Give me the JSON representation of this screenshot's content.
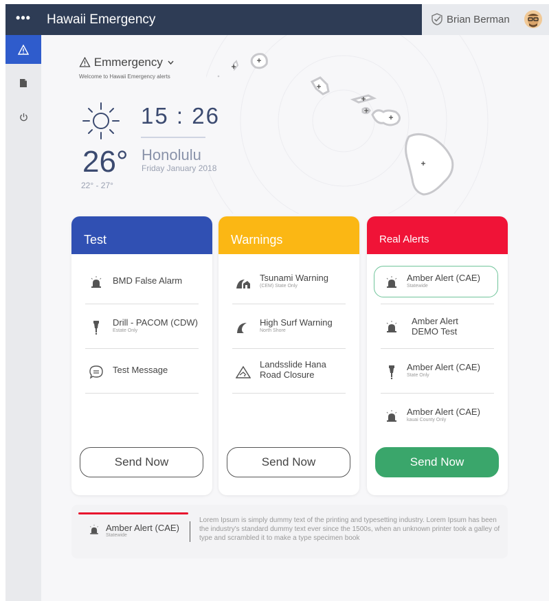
{
  "topbar": {
    "menu_glyph": "•••",
    "title": "Hawaii Emergency",
    "user_name": "Brian Berman"
  },
  "sidebar": {
    "items": [
      {
        "icon": "warning-icon",
        "glyph": "⚠",
        "active": true
      },
      {
        "icon": "document-icon",
        "glyph": "▮",
        "active": false
      },
      {
        "icon": "power-icon",
        "glyph": "⏻",
        "active": false
      }
    ]
  },
  "header": {
    "section_title": "Emmergency",
    "subtitle": "Welcome to Hawaii Emergency alerts",
    "time": "15 : 26",
    "temperature": "26°",
    "city": "Honolulu",
    "date": "Friday  January  2018",
    "temp_range": "22° - 27°"
  },
  "cards": [
    {
      "title": "Test",
      "color": "#3050b3",
      "items": [
        {
          "icon": "siren-icon",
          "label": "BMD False Alarm",
          "sub": ""
        },
        {
          "icon": "sprinkler-icon",
          "label": "Drill - PACOM (CDW)",
          "sub": "Estate Only"
        },
        {
          "icon": "chat-bubble-icon",
          "label": "Test Message",
          "sub": ""
        }
      ],
      "button": "Send Now"
    },
    {
      "title": "Warnings",
      "color": "#fbb714",
      "items": [
        {
          "icon": "tsunami-icon",
          "label": "Tsunami Warning",
          "sub": "(CEM) State Only"
        },
        {
          "icon": "wave-icon",
          "label": "High Surf Warning",
          "sub": "North Shore"
        },
        {
          "icon": "landslide-icon",
          "label": "Landsslide Hana Road Closure",
          "sub": ""
        }
      ],
      "button": "Send Now"
    },
    {
      "title": "Real Alerts",
      "color": "#f01337",
      "items": [
        {
          "icon": "siren-icon",
          "label": "Amber Alert (CAE)",
          "sub": "Statewide"
        },
        {
          "icon": "siren-icon",
          "label": "Amber Alert DEMO Test",
          "sub": ""
        },
        {
          "icon": "sprinkler-icon",
          "label": "Amber Alert (CAE)",
          "sub": "State Only"
        },
        {
          "icon": "siren-icon",
          "label": "Amber Alert (CAE)",
          "sub": "kauai County Only"
        }
      ],
      "button": "Send Now"
    }
  ],
  "info": {
    "name": "Amber Alert (CAE)",
    "sub": "Statewide",
    "text": "Lorem Ipsum is simply dummy text of the printing and typesetting industry. Lorem Ipsum has been the industry's standard dummy text ever since the 1500s, when an unknown printer took a galley of type and scrambled it to make a type specimen book"
  },
  "colors": {
    "accent_blue": "#2f5ccc",
    "send_green": "#3aa66b",
    "alert_red": "#e8142e",
    "topbar": "#2e3c55"
  }
}
